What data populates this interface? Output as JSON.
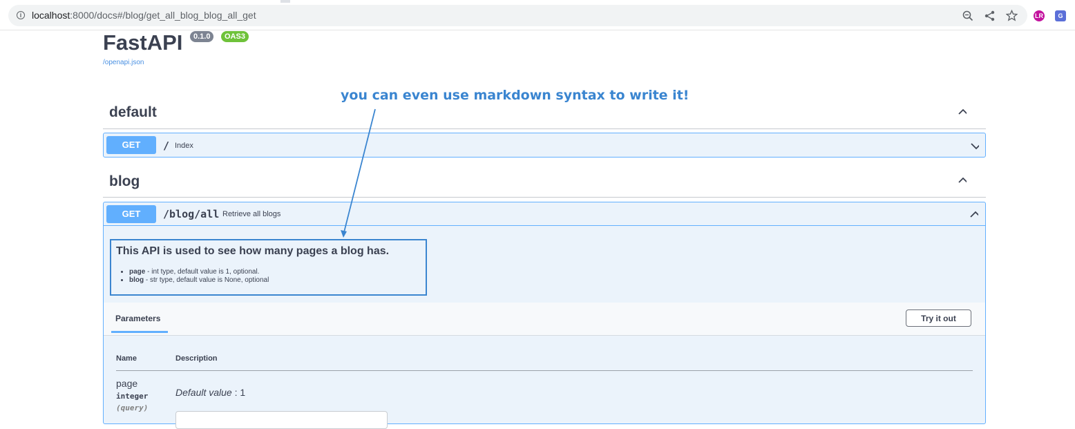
{
  "browser": {
    "url_host": "localhost",
    "url_rest": ":8000/docs#/blog/get_all_blog_blog_all_get",
    "icons": [
      "info-icon",
      "zoom-out-icon",
      "share-icon",
      "star-icon",
      "profile-extension-icon",
      "translate-extension-icon"
    ]
  },
  "header": {
    "title": "FastAPI",
    "version_badge": "0.1.0",
    "oas_badge": "OAS3",
    "openapi_link": "/openapi.json"
  },
  "annotation": {
    "text": "you can even use markdown syntax to write it!",
    "color": "#3a85d0"
  },
  "sections": [
    {
      "title": "default",
      "operations": [
        {
          "method": "GET",
          "path": "/",
          "summary": "Index"
        }
      ]
    },
    {
      "title": "blog",
      "operations": [
        {
          "method": "GET",
          "path": "/blog/all",
          "summary": "Retrieve all blogs"
        }
      ]
    }
  ],
  "expanded_operation": {
    "description_heading": "This API is used to see how many pages a blog has.",
    "description_items": [
      {
        "name": "page",
        "text": " - int type, default value is 1, optional."
      },
      {
        "name": "blog",
        "text": " - str type, default value is None, optional"
      }
    ],
    "params_tab": "Parameters",
    "try_button": "Try it out",
    "columns": [
      "Name",
      "Description"
    ],
    "parameters": [
      {
        "name": "page",
        "type": "integer",
        "in": "(query)",
        "default_label": "Default value",
        "default_sep": " : 1"
      }
    ]
  },
  "colors": {
    "get_method": "#61affe",
    "op_background": "#ebf3fb",
    "oas_badge": "#6fc23a",
    "version_badge": "#7d8492"
  }
}
